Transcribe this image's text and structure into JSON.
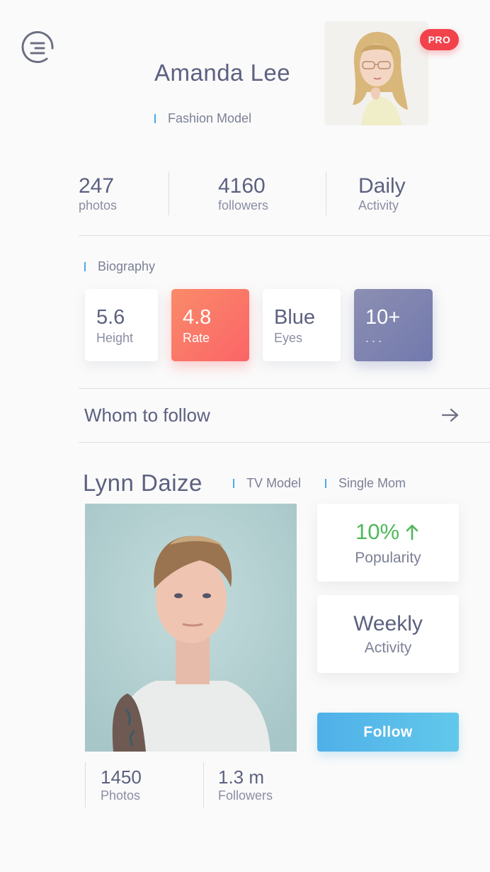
{
  "header": {
    "name": "Amanda Lee",
    "role": "Fashion Model",
    "badge": "PRO",
    "menu_icon": "menu-lines-icon"
  },
  "stats": [
    {
      "value": "247",
      "label": "photos"
    },
    {
      "value": "4160",
      "label": "followers"
    },
    {
      "value": "Daily",
      "label": "Activity"
    }
  ],
  "biography": {
    "label": "Biography",
    "cards": [
      {
        "value": "5.6",
        "label": "Height"
      },
      {
        "value": "4.8",
        "label": "Rate"
      },
      {
        "value": "Blue",
        "label": "Eyes"
      },
      {
        "value": "10+",
        "label": "..."
      }
    ]
  },
  "whom_to_follow": {
    "label": "Whom to follow",
    "icon": "arrow-right-icon"
  },
  "suggestion": {
    "name": "Lynn Daize",
    "tags": [
      "TV Model",
      "Single Mom"
    ],
    "popularity": {
      "value": "10%",
      "label": "Popularity",
      "icon": "arrow-up-icon"
    },
    "activity": {
      "value": "Weekly",
      "label": "Activity"
    },
    "follow_label": "Follow",
    "photos": {
      "value": "1450",
      "label": "Photos"
    },
    "followers": {
      "value": "1.3 m",
      "label": "Followers"
    }
  },
  "colors": {
    "accent_blue": "#4aa8e8",
    "pro_red": "#f2424b",
    "rate_orange": "#fc6468",
    "more_purple": "#7279ad",
    "popularity_green": "#4fb85a",
    "text_dark": "#5c6180"
  }
}
